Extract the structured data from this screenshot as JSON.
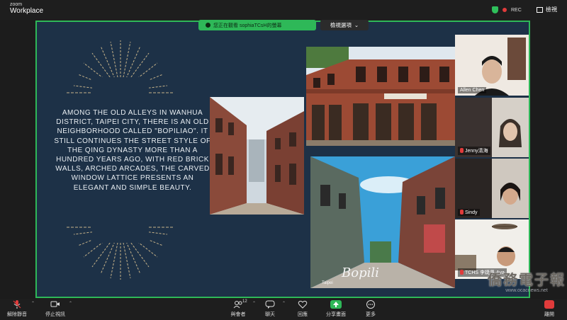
{
  "app": {
    "brand_small": "zoom",
    "brand_big": "Workplace"
  },
  "topbar": {
    "rec_label": "REC",
    "view_label": "檢視"
  },
  "share_banner": {
    "text": "您正在觀看 sophiaTCsH的螢幕",
    "view_options": "檢視選項"
  },
  "slide": {
    "body": "Among the old alleys in Wanhua District, Taipei City, there is an old neighborhood called \"Bopiliao\". It still continues the street style of the Qing Dynasty more than a hundred years ago, with red brick walls, arched arcades, the carved window lattice presents an elegant and simple beauty.",
    "photo_caption_script": "Bopili",
    "photo_caption_small": "Taipei"
  },
  "participants": [
    {
      "name": "Allen Chen",
      "muted": false
    },
    {
      "name": "Jenny清海",
      "muted": true
    },
    {
      "name": "Sindy",
      "muted": true
    },
    {
      "name": "TCHS 李婕恩 Ava",
      "muted": true
    }
  ],
  "toolbar": {
    "unmute": "解除靜音",
    "stop_video": "停止視訊",
    "participants": "與會者",
    "participant_count": "12",
    "chat": "聊天",
    "reactions": "回應",
    "share": "分享畫面",
    "more": "更多",
    "leave": "離開"
  },
  "watermark": {
    "big": "僑務電子報",
    "small": "www.ocacnews.net"
  },
  "colors": {
    "accent_green": "#2eb858",
    "slide_bg": "#1d3147",
    "brick": "#9c4a34"
  }
}
